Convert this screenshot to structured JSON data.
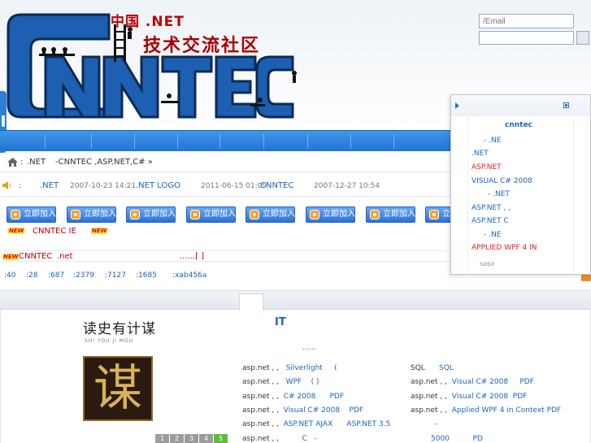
{
  "header": {
    "logo_cn": "中国 .NET",
    "logo_slogan": "技术交流社区",
    "logo_letters": "CNNTEC",
    "login_placeholder": "/Email"
  },
  "breadcrumb": {
    "sep": ":",
    "items": [
      ".NET",
      "-CNNTEC ,ASP.NET,C# »"
    ]
  },
  "news": {
    "items": [
      {
        "label": ":",
        "link": ".NET",
        "date": "2007-10-23 14:21"
      },
      {
        "link": ".NET   LOGO",
        "date": "2011-06-15 01:09"
      },
      {
        "link": "CNNTEC",
        "date": "2007-12-27 10:54"
      }
    ]
  },
  "join": {
    "button_label": "立即加入",
    "new_badge": "NEW",
    "group_text": "CNNTEC  IE"
  },
  "notice": {
    "a": "CNNTEC",
    "b": ".net",
    "c": "......[   ]"
  },
  "stats": [
    ":40",
    ":28",
    ":687",
    ":2379",
    ":7127",
    ":1685",
    ":xab456a"
  ],
  "content": {
    "list_title": "IT",
    "more": "......",
    "book": {
      "title": "读史有计谋",
      "subtitle": "SHI YOU JI MOU",
      "char": "谋",
      "pages": [
        "1",
        "2",
        "3",
        "4",
        "5"
      ]
    },
    "left_rows": [
      {
        "prefix": "asp.net ,  ,",
        "link": "Silverlight",
        "tail": "("
      },
      {
        "prefix": "asp.net ,  ,",
        "link": "WPF",
        "tail": "(   )"
      },
      {
        "prefix": "asp.net ,  ,",
        "link": "C# 2008",
        "tail": "PDF"
      },
      {
        "prefix": "asp.net ,  ,",
        "link": "Visual C# 2008",
        "tail": "PDF"
      },
      {
        "prefix": "asp.net ,  ,",
        "link": "ASP.NET AJAX",
        "tail": "ASP.NET 3.5"
      },
      {
        "prefix": "asp.net ,  ,",
        "link": "C",
        "tail": "-"
      }
    ],
    "right_rows": [
      {
        "prefix": "SQL",
        "link": "SQL",
        "tail": ""
      },
      {
        "prefix": "asp.net ,  ,",
        "link": "Visual C# 2008",
        "tail": "PDF"
      },
      {
        "prefix": "asp.net ,  ,",
        "link": "Visual C# 2008",
        "tail": "PDF"
      },
      {
        "prefix": "asp.net ,  ,",
        "link": "Applied WPF 4 in Context PDF",
        "tail": ""
      },
      {
        "prefix": "",
        "link": "-",
        "tail": ""
      },
      {
        "prefix": "",
        "link": "5000",
        "tail": "PD"
      }
    ]
  },
  "float_panel": {
    "title": "cnntec",
    "items": [
      {
        "text": "-    .NE",
        "style": "fp-blue"
      },
      {
        "text": ".NET",
        "style": "fp-blue"
      },
      {
        "text": "ASP.NET",
        "style": "fp-red"
      },
      {
        "text": "VISUAL C# 2008",
        "style": "fp-blue"
      },
      {
        "text": "-    .NET",
        "style": "fp-blue"
      },
      {
        "text": "ASP.NET  ,  ,",
        "style": "fp-blue"
      },
      {
        "text": "ASP.NET       C",
        "style": "fp-blue"
      },
      {
        "text": "-    .NE",
        "style": "fp-blue"
      },
      {
        "text": "APPLIED WPF 4 IN",
        "style": "fp-red"
      },
      {
        "text": "soso",
        "style": "fp-dark"
      }
    ]
  },
  "colors": {
    "brand_blue": "#1f74d0",
    "link_blue": "#1d63b8",
    "accent_red": "#c00000"
  }
}
